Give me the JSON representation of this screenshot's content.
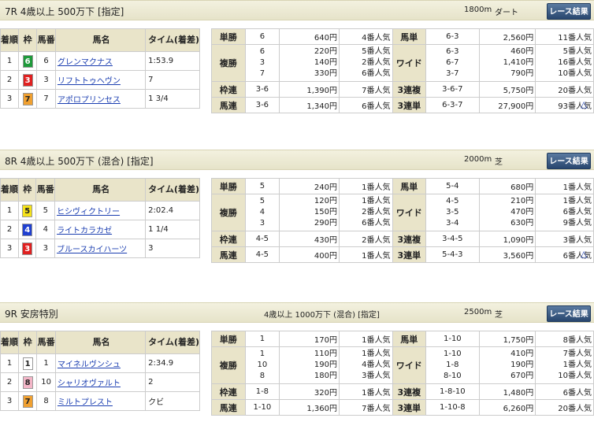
{
  "races": [
    {
      "title": "7R 4歳以上 500万下 [指定]",
      "conditions": "",
      "distance": "1800m",
      "surface": "ダート",
      "button": "レース結果",
      "headers": {
        "rank": "着順",
        "frame": "枠",
        "num": "馬番",
        "name": "馬名",
        "time": "タイム(着差)"
      },
      "results": [
        {
          "rank": "1",
          "frame": "6",
          "frame_bg": "#1e9a3a",
          "frame_fg": "#ffffff",
          "num": "6",
          "name": "グレンマクナス",
          "time": "1:53.9"
        },
        {
          "rank": "2",
          "frame": "3",
          "frame_bg": "#e02020",
          "frame_fg": "#ffffff",
          "num": "3",
          "name": "リフトトゥヘヴン",
          "time": "7"
        },
        {
          "rank": "3",
          "frame": "7",
          "frame_bg": "#f0a030",
          "frame_fg": "#222222",
          "num": "7",
          "name": "アポロプリンセス",
          "time": "1 3/4"
        }
      ],
      "payouts": {
        "tansho": {
          "label": "単勝",
          "combos": [
            "6"
          ],
          "yen": [
            "640円"
          ],
          "pop": [
            "4番人気"
          ]
        },
        "umatan": {
          "label": "馬単",
          "combos": [
            "6-3"
          ],
          "yen": [
            "2,560円"
          ],
          "pop": [
            "11番人気"
          ]
        },
        "fukusho": {
          "label": "複勝",
          "combos": [
            "6",
            "3",
            "7"
          ],
          "yen": [
            "220円",
            "140円",
            "330円"
          ],
          "pop": [
            "5番人気",
            "2番人気",
            "6番人気"
          ]
        },
        "wide": {
          "label": "ワイド",
          "combos": [
            "6-3",
            "6-7",
            "3-7"
          ],
          "yen": [
            "460円",
            "1,410円",
            "790円"
          ],
          "pop": [
            "5番人気",
            "16番人気",
            "10番人気"
          ]
        },
        "wakuren": {
          "label": "枠連",
          "combos": [
            "3-6"
          ],
          "yen": [
            "1,390円"
          ],
          "pop": [
            "7番人気"
          ]
        },
        "sanrenpuku": {
          "label": "3連複",
          "combos": [
            "3-6-7"
          ],
          "yen": [
            "5,750円"
          ],
          "pop": [
            "20番人気"
          ]
        },
        "umaren": {
          "label": "馬連",
          "combos": [
            "3-6"
          ],
          "yen": [
            "1,340円"
          ],
          "pop": [
            "6番人気"
          ]
        },
        "sanrentan": {
          "label": "3連単",
          "combos": [
            "6-3-7"
          ],
          "yen": [
            "27,900円"
          ],
          "pop": [
            "93番人気"
          ]
        }
      }
    },
    {
      "title": "8R 4歳以上 500万下 (混合) [指定]",
      "conditions": "",
      "distance": "2000m",
      "surface": "芝",
      "button": "レース結果",
      "headers": {
        "rank": "着順",
        "frame": "枠",
        "num": "馬番",
        "name": "馬名",
        "time": "タイム(着差)"
      },
      "results": [
        {
          "rank": "1",
          "frame": "5",
          "frame_bg": "#f5e21a",
          "frame_fg": "#222222",
          "num": "5",
          "name": "ヒシヴィクトリー",
          "time": "2:02.4"
        },
        {
          "rank": "2",
          "frame": "4",
          "frame_bg": "#2040d0",
          "frame_fg": "#ffffff",
          "num": "4",
          "name": "ライトカラカゼ",
          "time": "1 1/4"
        },
        {
          "rank": "3",
          "frame": "3",
          "frame_bg": "#e02020",
          "frame_fg": "#ffffff",
          "num": "3",
          "name": "ブルースカイハーツ",
          "time": "3"
        }
      ],
      "payouts": {
        "tansho": {
          "label": "単勝",
          "combos": [
            "5"
          ],
          "yen": [
            "240円"
          ],
          "pop": [
            "1番人気"
          ]
        },
        "umatan": {
          "label": "馬単",
          "combos": [
            "5-4"
          ],
          "yen": [
            "680円"
          ],
          "pop": [
            "1番人気"
          ]
        },
        "fukusho": {
          "label": "複勝",
          "combos": [
            "5",
            "4",
            "3"
          ],
          "yen": [
            "120円",
            "150円",
            "290円"
          ],
          "pop": [
            "1番人気",
            "2番人気",
            "6番人気"
          ]
        },
        "wide": {
          "label": "ワイド",
          "combos": [
            "4-5",
            "3-5",
            "3-4"
          ],
          "yen": [
            "210円",
            "470円",
            "630円"
          ],
          "pop": [
            "1番人気",
            "6番人気",
            "9番人気"
          ]
        },
        "wakuren": {
          "label": "枠連",
          "combos": [
            "4-5"
          ],
          "yen": [
            "430円"
          ],
          "pop": [
            "2番人気"
          ]
        },
        "sanrenpuku": {
          "label": "3連複",
          "combos": [
            "3-4-5"
          ],
          "yen": [
            "1,090円"
          ],
          "pop": [
            "3番人気"
          ]
        },
        "umaren": {
          "label": "馬連",
          "combos": [
            "4-5"
          ],
          "yen": [
            "400円"
          ],
          "pop": [
            "1番人気"
          ]
        },
        "sanrentan": {
          "label": "3連単",
          "combos": [
            "5-4-3"
          ],
          "yen": [
            "3,560円"
          ],
          "pop": [
            "6番人気"
          ]
        }
      }
    },
    {
      "title": "9R 安房特別",
      "conditions": "4歳以上 1000万下 (混合) [指定]",
      "distance": "2500m",
      "surface": "芝",
      "button": "レース結果",
      "headers": {
        "rank": "着順",
        "frame": "枠",
        "num": "馬番",
        "name": "馬名",
        "time": "タイム(着差)"
      },
      "results": [
        {
          "rank": "1",
          "frame": "1",
          "frame_bg": "#ffffff",
          "frame_fg": "#222222",
          "num": "1",
          "name": "マイネルヴンシュ",
          "time": "2:34.9"
        },
        {
          "rank": "2",
          "frame": "8",
          "frame_bg": "#f4b6c8",
          "frame_fg": "#222222",
          "num": "10",
          "name": "シャリオヴァルト",
          "time": "2"
        },
        {
          "rank": "3",
          "frame": "7",
          "frame_bg": "#f0a030",
          "frame_fg": "#222222",
          "num": "8",
          "name": "ミルトプレスト",
          "time": "クビ"
        }
      ],
      "payouts": {
        "tansho": {
          "label": "単勝",
          "combos": [
            "1"
          ],
          "yen": [
            "170円"
          ],
          "pop": [
            "1番人気"
          ]
        },
        "umatan": {
          "label": "馬単",
          "combos": [
            "1-10"
          ],
          "yen": [
            "1,750円"
          ],
          "pop": [
            "8番人気"
          ]
        },
        "fukusho": {
          "label": "複勝",
          "combos": [
            "1",
            "10",
            "8"
          ],
          "yen": [
            "110円",
            "190円",
            "180円"
          ],
          "pop": [
            "1番人気",
            "4番人気",
            "3番人気"
          ]
        },
        "wide": {
          "label": "ワイド",
          "combos": [
            "1-10",
            "1-8",
            "8-10"
          ],
          "yen": [
            "410円",
            "190円",
            "670円"
          ],
          "pop": [
            "7番人気",
            "1番人気",
            "10番人気"
          ]
        },
        "wakuren": {
          "label": "枠連",
          "combos": [
            "1-8"
          ],
          "yen": [
            "320円"
          ],
          "pop": [
            "1番人気"
          ]
        },
        "sanrenpuku": {
          "label": "3連複",
          "combos": [
            "1-8-10"
          ],
          "yen": [
            "1,480円"
          ],
          "pop": [
            "6番人気"
          ]
        },
        "umaren": {
          "label": "馬連",
          "combos": [
            "1-10"
          ],
          "yen": [
            "1,360円"
          ],
          "pop": [
            "7番人気"
          ]
        },
        "sanrentan": {
          "label": "3連単",
          "combos": [
            "1-10-8"
          ],
          "yen": [
            "6,260円"
          ],
          "pop": [
            "20番人気"
          ]
        }
      }
    }
  ],
  "page_top_icon": "triangle-up-icon"
}
